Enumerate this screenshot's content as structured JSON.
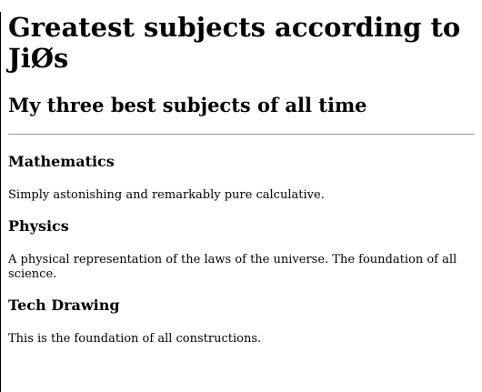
{
  "header": {
    "title": "Greatest subjects according to JiØs",
    "subtitle": "My three best subjects of all time"
  },
  "subjects": [
    {
      "name": "Mathematics",
      "description": "Simply astonishing and remarkably pure calculative."
    },
    {
      "name": "Physics",
      "description": "A physical representation of the laws of the universe. The foundation of all science."
    },
    {
      "name": "Tech Drawing",
      "description": "This is the foundation of all constructions."
    }
  ]
}
